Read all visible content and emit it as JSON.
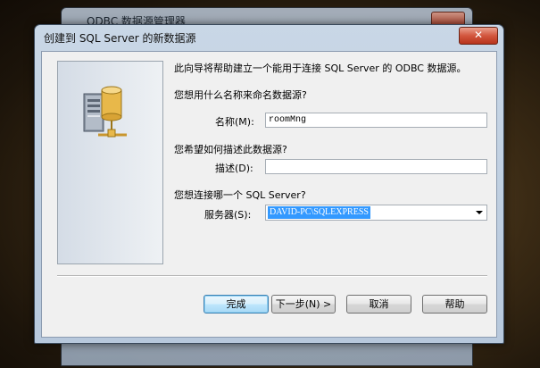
{
  "background_window": {
    "title": "ODBC 数据源管理器"
  },
  "dialog": {
    "title": "创建到 SQL Server 的新数据源",
    "close_symbol": "✕",
    "intro": "此向导将帮助建立一个能用于连接 SQL Server 的 ODBC 数据源。",
    "name_question": "您想用什么名称来命名数据源?",
    "name_label": "名称(M):",
    "name_value": "roomMng",
    "desc_question": "您希望如何描述此数据源?",
    "desc_label": "描述(D):",
    "desc_value": "",
    "server_question": "您想连接哪一个 SQL Server?",
    "server_label": "服务器(S):",
    "server_value": "DAVID-PC\\SQLEXPRESS"
  },
  "buttons": {
    "finish": "完成",
    "next": "下一步(N) >",
    "cancel": "取消",
    "help": "帮助"
  },
  "icons": {
    "side": "server-database-icon",
    "close": "close-icon",
    "dropdown": "chevron-down-icon"
  },
  "colors": {
    "selection": "#3399ff",
    "close_button": "#c7452d",
    "default_button": "#bee6fd"
  }
}
